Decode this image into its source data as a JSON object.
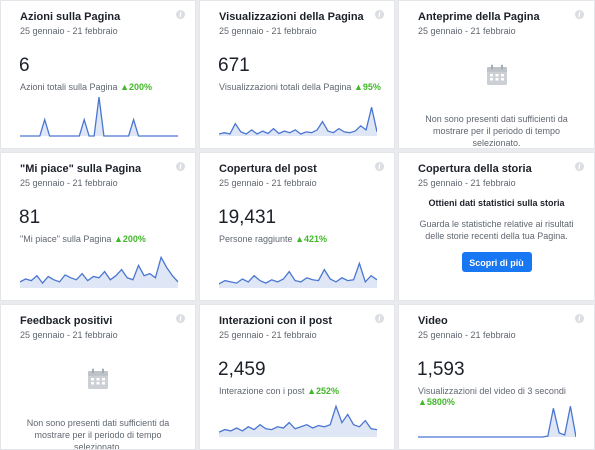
{
  "date_range": "25 gennaio - 21 febbraio",
  "info_glyph": "i",
  "empty_msg": "Non sono presenti dati sufficienti da mostrare per il periodo di tempo selezionato.",
  "colors": {
    "up": "#42b72a",
    "line": "#4a76d2",
    "area": "#dfe7f7",
    "button": "#1877f2"
  },
  "cards": {
    "page_actions": {
      "title": "Azioni sulla Pagina",
      "value": "6",
      "label": "Azioni totali sulla Pagina",
      "change": "▲200%",
      "trend": [
        0,
        0,
        0,
        0,
        0,
        0.4,
        0,
        0,
        0,
        0,
        0,
        0,
        0,
        0.4,
        0,
        0,
        0.95,
        0,
        0,
        0,
        0,
        0,
        0,
        0.4,
        0,
        0,
        0,
        0,
        0,
        0,
        0,
        0,
        0
      ]
    },
    "page_views": {
      "title": "Visualizzazioni della Pagina",
      "value": "671",
      "label": "Visualizzazioni totali della Pagina",
      "change": "▲95%",
      "trend": [
        0.05,
        0.08,
        0.05,
        0.3,
        0.1,
        0.05,
        0.15,
        0.05,
        0.12,
        0.06,
        0.18,
        0.06,
        0.12,
        0.08,
        0.15,
        0.05,
        0.1,
        0.08,
        0.15,
        0.35,
        0.12,
        0.08,
        0.18,
        0.1,
        0.08,
        0.12,
        0.25,
        0.15,
        0.7,
        0.1
      ]
    },
    "page_previews": {
      "title": "Anteprime della Pagina",
      "icon": "calendar-icon"
    },
    "page_likes": {
      "title": "\"Mi piace\" sulla Pagina",
      "value": "81",
      "label": "\"Mi piace\" sulla Pagina",
      "change": "▲200%",
      "trend": [
        0.15,
        0.22,
        0.18,
        0.3,
        0.12,
        0.28,
        0.2,
        0.15,
        0.32,
        0.25,
        0.2,
        0.35,
        0.18,
        0.28,
        0.25,
        0.4,
        0.2,
        0.3,
        0.45,
        0.25,
        0.2,
        0.55,
        0.3,
        0.35,
        0.25,
        0.75,
        0.5,
        0.3,
        0.15
      ]
    },
    "post_reach": {
      "title": "Copertura del post",
      "value": "19,431",
      "label": "Persone raggiunte",
      "change": "▲421%",
      "trend": [
        0.1,
        0.18,
        0.15,
        0.12,
        0.22,
        0.15,
        0.3,
        0.18,
        0.12,
        0.2,
        0.15,
        0.22,
        0.4,
        0.18,
        0.15,
        0.25,
        0.2,
        0.18,
        0.45,
        0.22,
        0.15,
        0.25,
        0.18,
        0.2,
        0.6,
        0.15,
        0.3,
        0.2
      ]
    },
    "story_reach": {
      "title": "Copertura della storia",
      "heading": "Ottieni dati statistici sulla storia",
      "description": "Guarda le statistiche relative ai risultati delle storie recenti della tua Pagina.",
      "button": "Scopri di più"
    },
    "positive_feedback": {
      "title": "Feedback positivi",
      "icon": "calendar-icon"
    },
    "post_engagement": {
      "title": "Interazioni con il post",
      "value": "2,459",
      "label": "Interazione con i post",
      "change": "▲252%",
      "trend": [
        0.12,
        0.18,
        0.15,
        0.22,
        0.15,
        0.25,
        0.18,
        0.3,
        0.2,
        0.18,
        0.25,
        0.22,
        0.35,
        0.2,
        0.25,
        0.3,
        0.22,
        0.28,
        0.25,
        0.3,
        0.75,
        0.35,
        0.55,
        0.3,
        0.25,
        0.4,
        0.2,
        0.18
      ]
    },
    "video": {
      "title": "Video",
      "value": "1,593",
      "label": "Visualizzazioni del video di 3 secondi",
      "change": "▲5800%",
      "trend": [
        0,
        0,
        0,
        0,
        0,
        0,
        0,
        0,
        0,
        0,
        0,
        0,
        0,
        0,
        0,
        0,
        0,
        0,
        0,
        0,
        0,
        0,
        0,
        0.02,
        0.7,
        0.1,
        0.05,
        0.75,
        0
      ]
    }
  }
}
